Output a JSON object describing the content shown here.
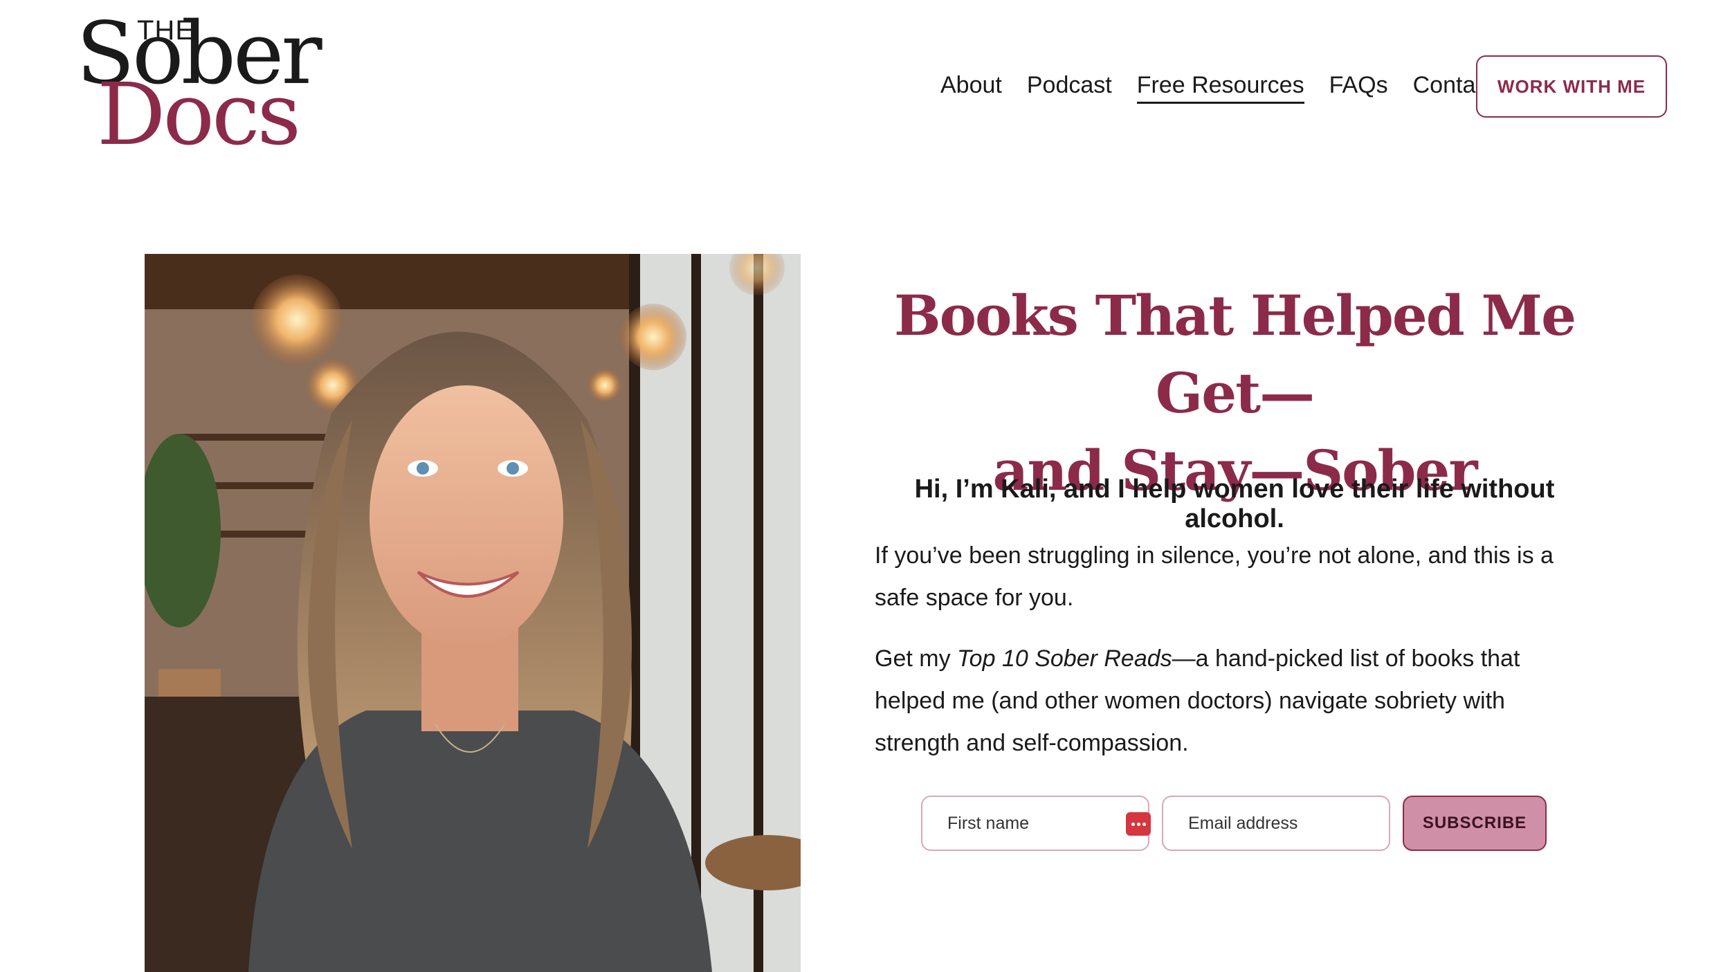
{
  "logo": {
    "the": "THE",
    "sober": "Sober",
    "docs": "Docs"
  },
  "nav": {
    "items": [
      {
        "label": "About"
      },
      {
        "label": "Podcast"
      },
      {
        "label": "Free Resources",
        "active": true
      },
      {
        "label": "FAQs"
      },
      {
        "label": "Contact"
      }
    ],
    "cta_label": "WORK WITH ME"
  },
  "hero": {
    "headline_line1": "Books That Helped Me Get—",
    "headline_line2": "and Stay—Sober",
    "intro": "Hi, I’m Kali, and I help women love their life without alcohol.",
    "para1": "If you’ve been struggling in silence, you’re not alone, and this is a safe space for you.",
    "para2_prefix": "Get my ",
    "para2_italic": "Top 10 Sober Reads",
    "para2_suffix": "—a hand-picked list of books that helped me (and other women doctors) navigate sobriety with strength and self-compassion."
  },
  "form": {
    "first_name_placeholder": "First name",
    "email_placeholder": "Email address",
    "subscribe_label": "SUBSCRIBE"
  },
  "colors": {
    "brand": "#8c2a4a",
    "button_fill": "#cf8fa7",
    "field_border": "#d9a7b8"
  }
}
